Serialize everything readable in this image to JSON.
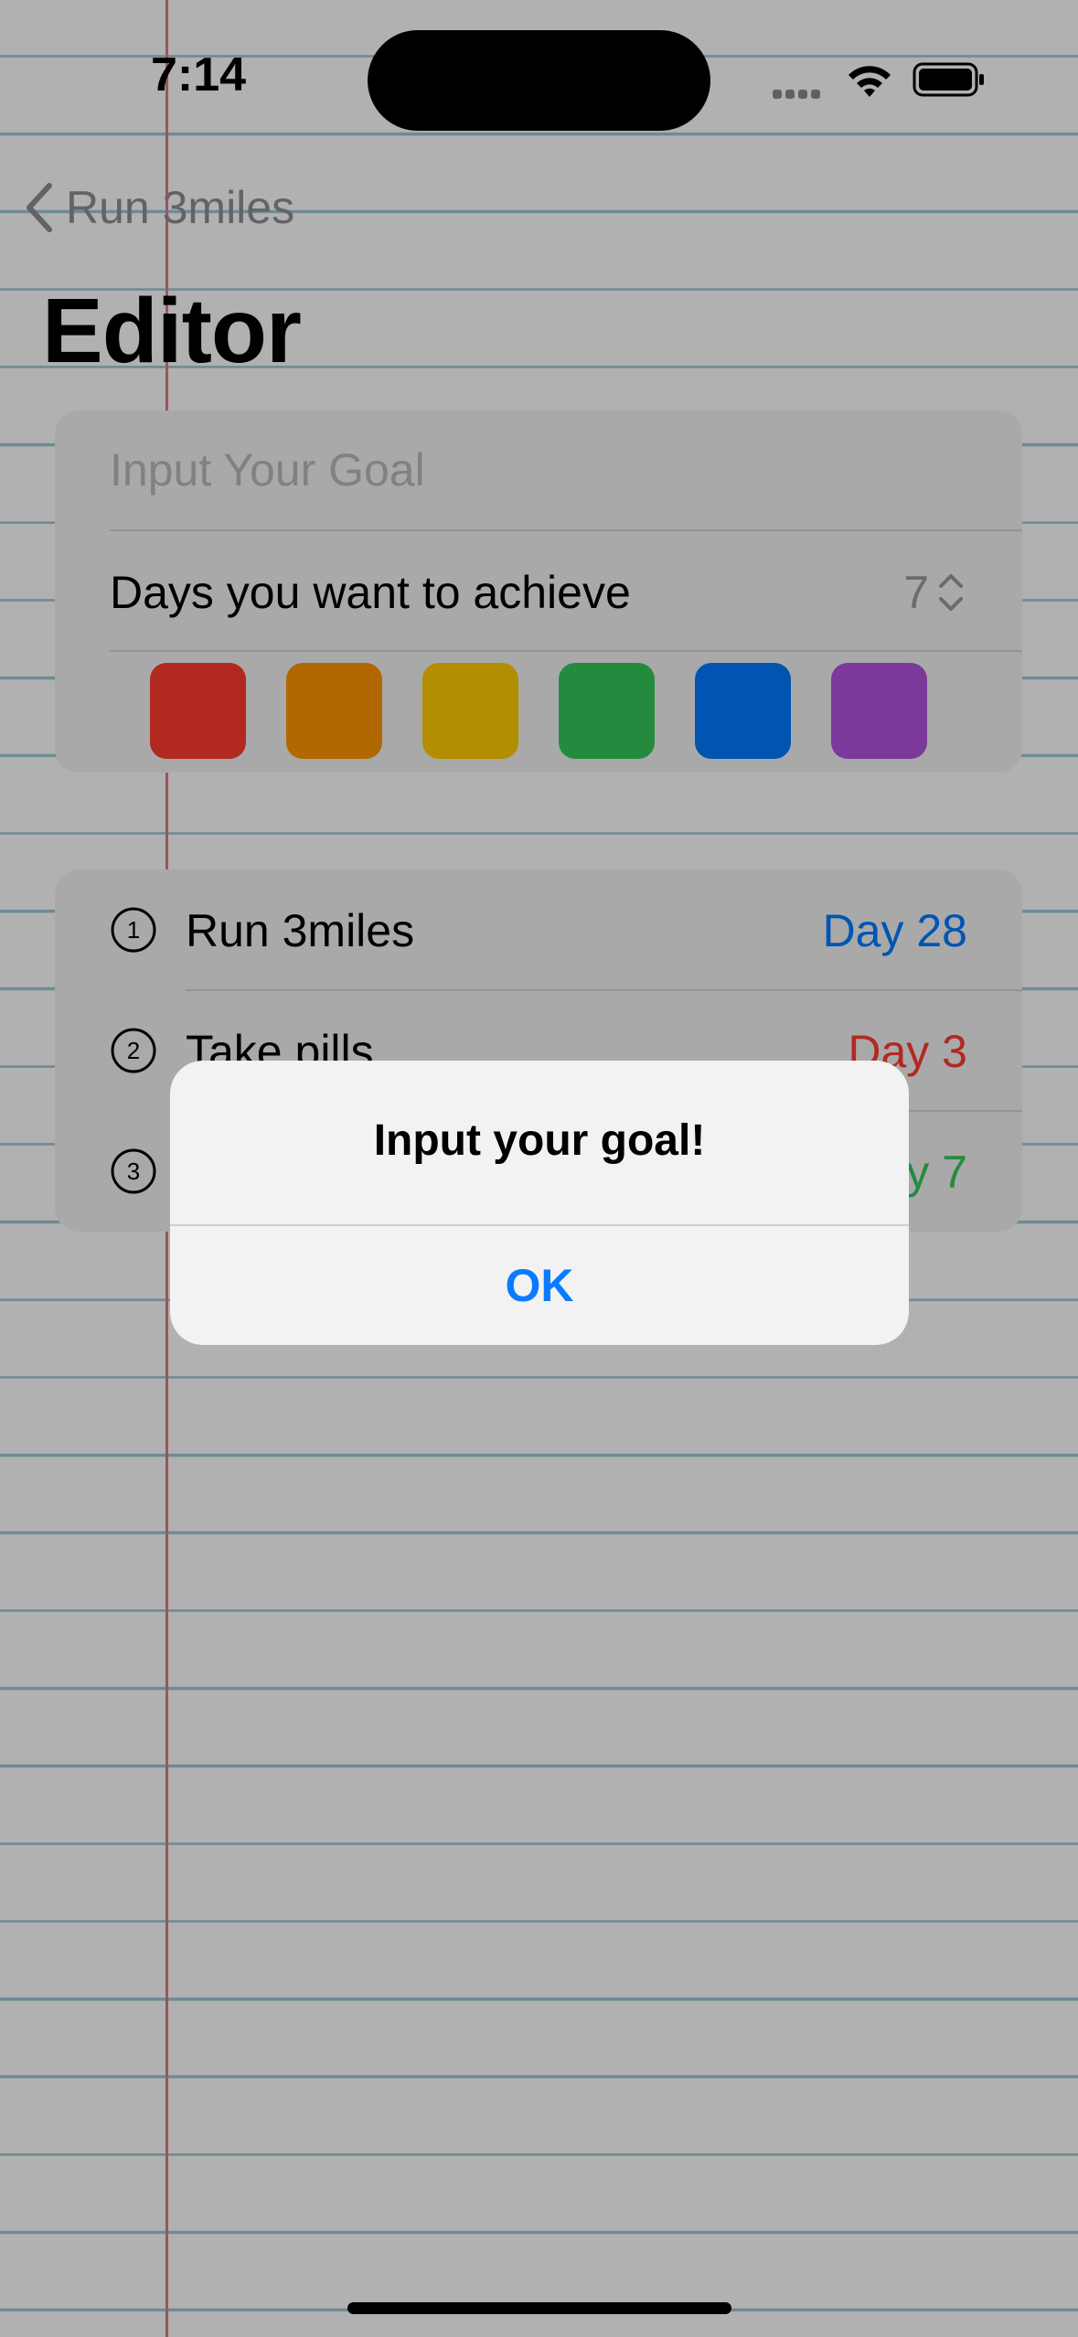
{
  "status_bar": {
    "time": "7:14",
    "icons": [
      "cellular-signal-icon",
      "wifi-icon",
      "battery-icon"
    ]
  },
  "nav": {
    "back_label": "Run 3miles",
    "title": "Editor"
  },
  "form": {
    "goal_placeholder": "Input Your Goal",
    "goal_value": "",
    "days_label": "Days you want to achieve",
    "days_value": "7",
    "colors": [
      {
        "name": "red",
        "hex": "#ff3b30"
      },
      {
        "name": "orange",
        "hex": "#ff9500"
      },
      {
        "name": "yellow",
        "hex": "#ffcc00"
      },
      {
        "name": "green",
        "hex": "#34c759"
      },
      {
        "name": "blue",
        "hex": "#007aff"
      },
      {
        "name": "purple",
        "hex": "#af52de"
      }
    ]
  },
  "goals": [
    {
      "number": "1",
      "name": "Run 3miles",
      "day": "Day 28",
      "color": "#007aff"
    },
    {
      "number": "2",
      "name": "Take pills",
      "day": "Day 3",
      "color": "#ff3b30"
    },
    {
      "number": "3",
      "name": "",
      "day": "Day 7",
      "color": "#34c759"
    }
  ],
  "alert": {
    "title": "Input your goal!",
    "ok_label": "OK"
  }
}
